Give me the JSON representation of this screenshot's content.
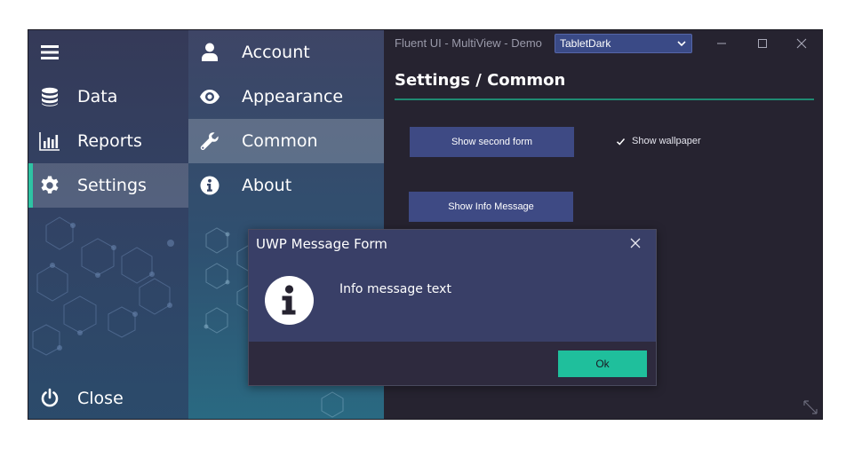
{
  "app": {
    "title": "Fluent UI - MultiView - Demo",
    "theme_selected": "TabletDark"
  },
  "nav": {
    "items": [
      {
        "label": "Data",
        "icon": "database-icon"
      },
      {
        "label": "Reports",
        "icon": "bar-chart-icon"
      },
      {
        "label": "Settings",
        "icon": "gear-icon"
      }
    ],
    "close_label": "Close",
    "selected": "Settings",
    "accent": "#2ec3a4"
  },
  "submenu": {
    "items": [
      {
        "label": "Account",
        "icon": "user-icon"
      },
      {
        "label": "Appearance",
        "icon": "eye-icon"
      },
      {
        "label": "Common",
        "icon": "wrench-icon"
      },
      {
        "label": "About",
        "icon": "info-icon"
      }
    ],
    "selected": "Common"
  },
  "content": {
    "heading": "Settings / Common",
    "show_second_form": "Show second form",
    "show_info_message": "Show Info Message",
    "show_wallpaper": "Show wallpaper",
    "show_wallpaper_checked": true
  },
  "dialog": {
    "title": "UWP Message Form",
    "message": "Info message text",
    "ok_label": "Ok",
    "ok_color": "#1fbf9c"
  }
}
